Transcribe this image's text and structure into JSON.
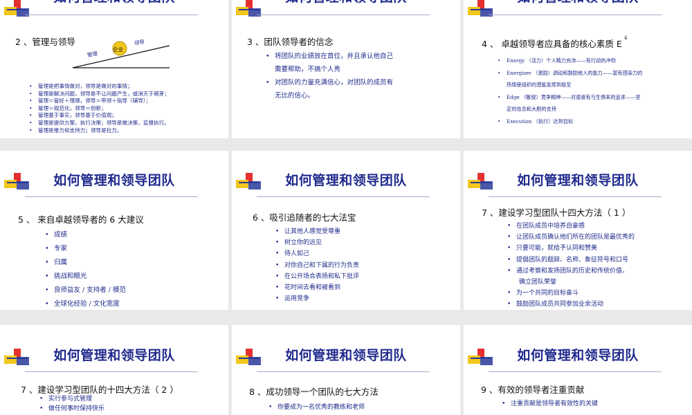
{
  "slide_title": "如何管理和领导团队",
  "slides": {
    "s1": {
      "heading": "2 、管理与领导",
      "diagram": {
        "circle": "企业",
        "left": "管理",
        "right": "领导"
      },
      "bullets": [
        "管理是把事情做对，领导是做对的事情；",
        "管理是解决问题，领导是不让问题产生，或消灭于萌芽；",
        "管理＝管好＋理顺，领导＝带领＋指导（辅导）；",
        "管理＝规范化，领导＝创新；",
        "管理基于事实，领导基于价值观；",
        "管理是提供方案，执行决策；领导是做决策，监督执行。",
        "管理是推力和支持力；领导是拉力。"
      ]
    },
    "s2": {
      "heading": "3 、团队领导者的信念",
      "bullets": [
        "将团队的业绩放在首位，并且承认他自己",
        "需要帮助，不搞个人秀",
        "对团队的力量充满信心，对团队的成员有",
        "无比的信心。"
      ]
    },
    "s3": {
      "heading": "4 、  卓越领导者应具备的核心素质 E",
      "sup": "4",
      "bullets": [
        "Energy （活力）个人精力充沛——有行动的冲劲",
        "Energizer （激励）调动和鼓励他人的能力——富有感染力的",
        "热情使组织的潜能发挥到极至",
        "Edge （敏锐）竞争精神——对速度有与生俱来的追求——坚",
        "定的信念和大胆的支持",
        "Execution （执行）达到目标"
      ]
    },
    "s4": {
      "heading": "5 、  来自卓越领导者的 6 大建议",
      "bullets": [
        "成绩",
        "专家",
        "归属",
        "挑战和眼光",
        "良师益友 / 支持者 / 模范",
        "全球化经验 / 文化宽度"
      ]
    },
    "s5": {
      "heading": "6 、吸引追随者的七大法宝",
      "bullets": [
        "让其他人感觉受尊重",
        "树立你的远见",
        "待人如己",
        "对你自己和下属的行为负责",
        "在公开场合表扬和私下批评",
        "花时间去看和被看到",
        "运用竞争"
      ]
    },
    "s6": {
      "heading": "7 、建设学习型团队十四大方法（ 1 ）",
      "bullets": [
        "在团队成员中培养自豪感",
        "让团队成员确认他们所在的团队是最优秀的",
        "只要可能，就给予认同和赞美",
        "提倡团队的题辞、名称、象征符号和口号",
        "通过考察和发扬团队的历史和传统价值，",
        "确立团队荣誉",
        "为一个共同的目标奋斗",
        "鼓励团队成员共同参加业余活动"
      ]
    },
    "s7": {
      "heading": "7 、建设学习型团队的十四大方法（ 2 ）",
      "bullets": [
        "实行参与式管理",
        "做任何事时保持快乐"
      ]
    },
    "s8": {
      "heading": "8 、成功领导一个团队的七大方法",
      "bullets": [
        "你要成为一名优秀的教练和老师"
      ]
    },
    "s9": {
      "heading": "9 、有效的领导者注重贡献",
      "bullets": [
        "注重贡献是领导者有效性的关键"
      ]
    }
  }
}
